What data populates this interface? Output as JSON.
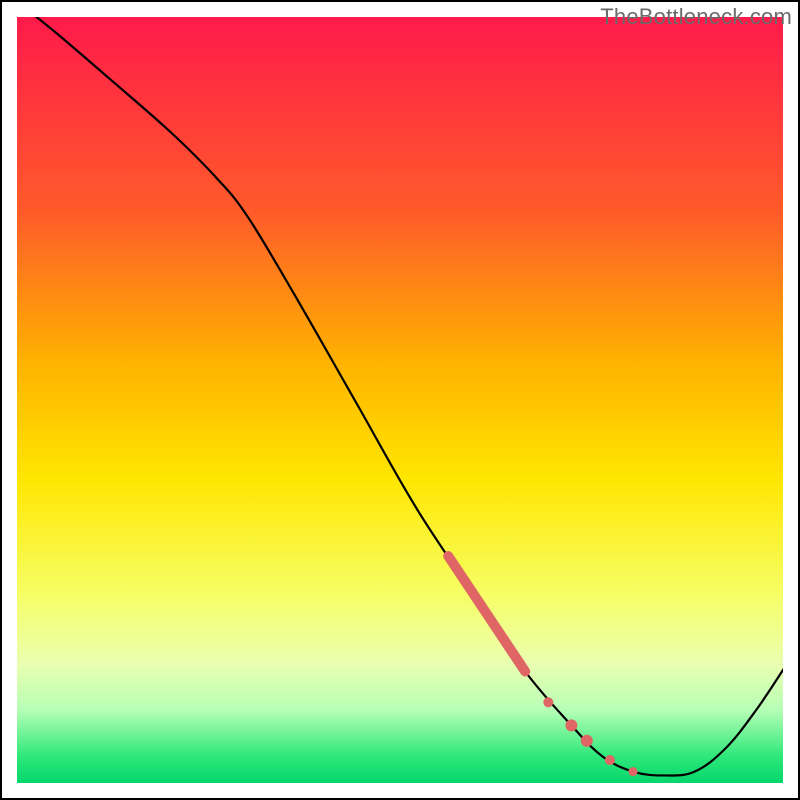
{
  "watermark": "TheBottleneck.com",
  "chart_data": {
    "type": "line",
    "title": "",
    "xlabel": "",
    "ylabel": "",
    "xlim": [
      0,
      100
    ],
    "ylim": [
      0,
      100
    ],
    "gradient_stops": [
      {
        "offset": 0,
        "color": "#ff1a4b"
      },
      {
        "offset": 25,
        "color": "#ff5a2a"
      },
      {
        "offset": 45,
        "color": "#ffb300"
      },
      {
        "offset": 60,
        "color": "#ffe600"
      },
      {
        "offset": 75,
        "color": "#f6ff66"
      },
      {
        "offset": 84,
        "color": "#eaffb0"
      },
      {
        "offset": 90,
        "color": "#b6ffb6"
      },
      {
        "offset": 96,
        "color": "#2ee87a"
      },
      {
        "offset": 100,
        "color": "#00d46a"
      }
    ],
    "series": [
      {
        "name": "curve",
        "color": "#000000",
        "width": 2.2,
        "points": [
          {
            "x": 0,
            "y": 102
          },
          {
            "x": 5,
            "y": 98
          },
          {
            "x": 12,
            "y": 92
          },
          {
            "x": 20,
            "y": 85
          },
          {
            "x": 26,
            "y": 79
          },
          {
            "x": 30,
            "y": 74
          },
          {
            "x": 36,
            "y": 64
          },
          {
            "x": 44,
            "y": 50
          },
          {
            "x": 52,
            "y": 36
          },
          {
            "x": 60,
            "y": 24
          },
          {
            "x": 66,
            "y": 15
          },
          {
            "x": 72,
            "y": 8
          },
          {
            "x": 76,
            "y": 4
          },
          {
            "x": 80,
            "y": 2
          },
          {
            "x": 84,
            "y": 1.5
          },
          {
            "x": 88,
            "y": 2
          },
          {
            "x": 92,
            "y": 5
          },
          {
            "x": 96,
            "y": 10
          },
          {
            "x": 100,
            "y": 16
          }
        ]
      }
    ],
    "highlight": {
      "color": "#e06666",
      "segment_width": 10,
      "segment": [
        {
          "x": 56,
          "y": 30
        },
        {
          "x": 66,
          "y": 15
        }
      ],
      "dots": [
        {
          "x": 69,
          "y": 11,
          "r": 5
        },
        {
          "x": 72,
          "y": 8,
          "r": 6
        },
        {
          "x": 74,
          "y": 6,
          "r": 6
        },
        {
          "x": 77,
          "y": 3.5,
          "r": 5
        },
        {
          "x": 80,
          "y": 2,
          "r": 4.5
        }
      ]
    }
  }
}
